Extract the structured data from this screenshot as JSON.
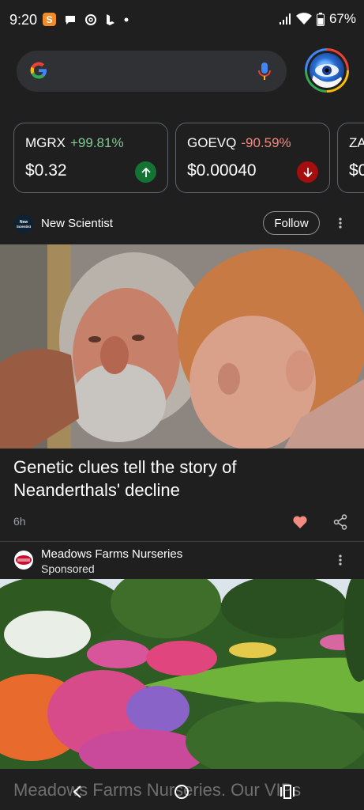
{
  "status": {
    "time": "9:20",
    "s_icon": "S",
    "battery": "67%",
    "icons": [
      "s-app-icon",
      "message-bubble-icon",
      "threads-icon",
      "bing-icon",
      "dot-icon",
      "signal-icon",
      "wifi-icon",
      "battery-icon"
    ]
  },
  "search": {
    "icons": [
      "google-g-icon",
      "mic-icon"
    ]
  },
  "stocks": [
    {
      "ticker": "MGRX",
      "change": "+99.81%",
      "price": "$0.32",
      "direction": "up",
      "change_color": "#81c995",
      "badge_color": "#137333"
    },
    {
      "ticker": "GOEVQ",
      "change": "-90.59%",
      "price": "$0.00040",
      "direction": "down",
      "change_color": "#f28b82",
      "badge_color": "#a50e0e"
    },
    {
      "ticker": "ZA",
      "change": "",
      "price": "$0",
      "direction": "",
      "change_color": "",
      "badge_color": ""
    }
  ],
  "article1": {
    "source": "New Scientist",
    "source_logo_text": "New Scientist",
    "follow_label": "Follow",
    "headline": "Genetic clues tell the story of Neanderthals' decline",
    "age": "6h",
    "liked": true,
    "heart_color": "#f28b82"
  },
  "article2": {
    "source": "Meadows Farms Nurseries",
    "sponsored_label": "Sponsored",
    "title_partial": "Meadows Farms Nurseries. Our VIPs"
  },
  "nav": {
    "icons": [
      "back-icon",
      "home-icon",
      "recents-icon"
    ]
  }
}
